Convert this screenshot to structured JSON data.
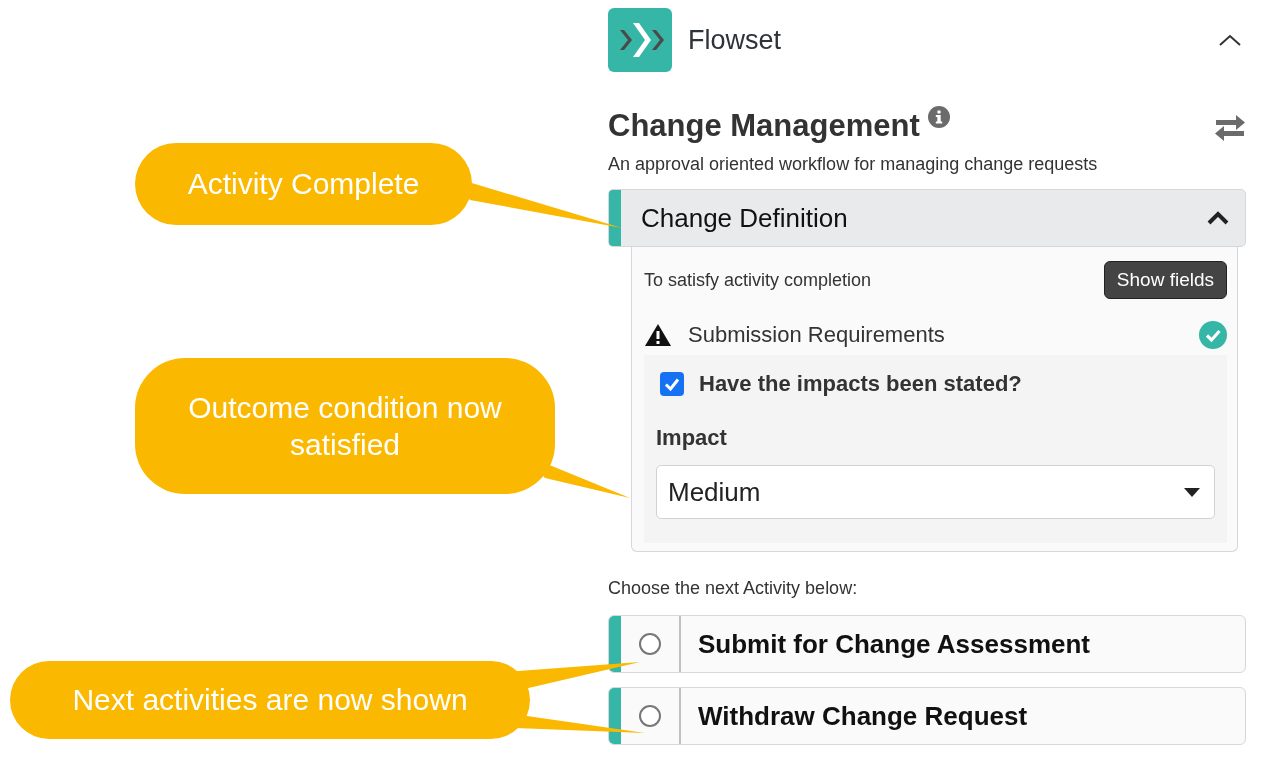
{
  "header": {
    "app_name": "Flowset",
    "expanded": true
  },
  "workflow": {
    "title": "Change Management",
    "description": "An approval oriented workflow for managing change requests"
  },
  "activity": {
    "title": "Change Definition",
    "completed": true,
    "expanded": true,
    "hint": "To satisfy activity completion",
    "button": "Show fields",
    "requirements": {
      "title": "Submission Requirements",
      "satisfied": true,
      "checkbox": {
        "label": "Have the impacts been stated?",
        "checked": true
      },
      "field": {
        "label": "Impact",
        "value": "Medium"
      }
    }
  },
  "next": {
    "prompt": "Choose the next Activity below:",
    "options": [
      {
        "label": "Submit for Change Assessment",
        "selected": false
      },
      {
        "label": "Withdraw Change Request",
        "selected": false
      }
    ]
  },
  "callouts": [
    {
      "text": "Activity Complete"
    },
    {
      "text": "Outcome condition now satisfied"
    },
    {
      "text": "Next activities are now shown"
    }
  ]
}
